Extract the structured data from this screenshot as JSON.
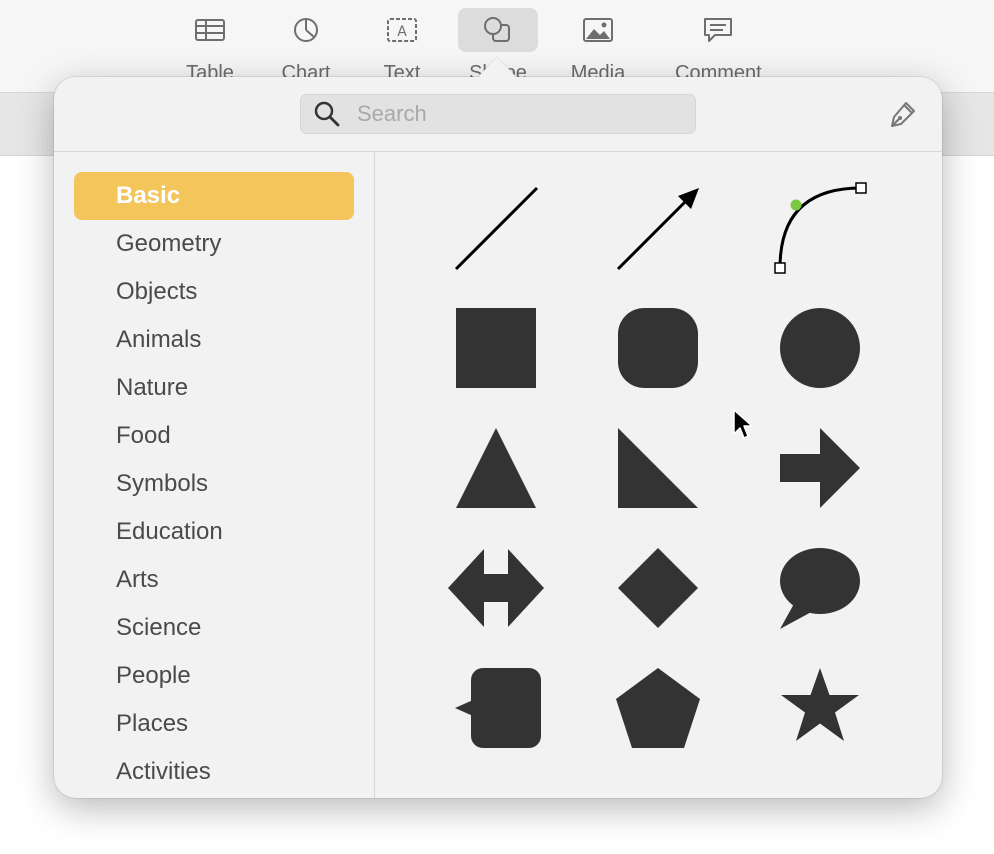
{
  "toolbar": {
    "items": [
      {
        "label": "Table",
        "icon": "table-icon"
      },
      {
        "label": "Chart",
        "icon": "chart-icon"
      },
      {
        "label": "Text",
        "icon": "text-box-icon"
      },
      {
        "label": "Shape",
        "icon": "shape-icon",
        "active": true
      },
      {
        "label": "Media",
        "icon": "media-icon"
      },
      {
        "label": "Comment",
        "icon": "comment-icon"
      }
    ]
  },
  "search": {
    "placeholder": "Search",
    "value": ""
  },
  "categories": [
    {
      "label": "Basic",
      "selected": true
    },
    {
      "label": "Geometry"
    },
    {
      "label": "Objects"
    },
    {
      "label": "Animals"
    },
    {
      "label": "Nature"
    },
    {
      "label": "Food"
    },
    {
      "label": "Symbols"
    },
    {
      "label": "Education"
    },
    {
      "label": "Arts"
    },
    {
      "label": "Science"
    },
    {
      "label": "People"
    },
    {
      "label": "Places"
    },
    {
      "label": "Activities"
    }
  ],
  "shapes": [
    "line",
    "arrow-line",
    "curve",
    "square",
    "rounded-square",
    "circle",
    "triangle",
    "right-triangle",
    "arrow",
    "double-arrow",
    "diamond",
    "speech-bubble",
    "callout-square",
    "pentagon",
    "star"
  ],
  "colors": {
    "selected_category": "#f3c55b",
    "shape_fill": "#333333",
    "curve_point": "#7ac943"
  }
}
